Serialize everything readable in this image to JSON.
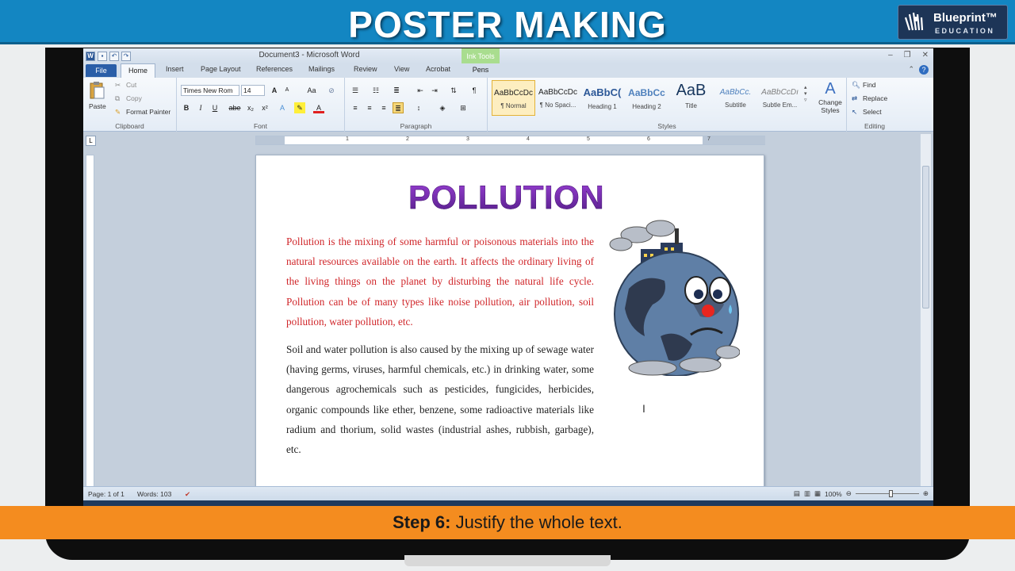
{
  "banner": {
    "title": "POSTER MAKING",
    "logo_name": "Blueprint™",
    "logo_sub": "EDUCATION"
  },
  "window": {
    "title": "Document3 - Microsoft Word",
    "context_tab": "Ink Tools"
  },
  "tabs": {
    "file": "File",
    "home": "Home",
    "insert": "Insert",
    "page_layout": "Page Layout",
    "references": "References",
    "mailings": "Mailings",
    "review": "Review",
    "view": "View",
    "acrobat": "Acrobat",
    "pens": "Pens"
  },
  "clipboard": {
    "paste": "Paste",
    "cut": "Cut",
    "copy": "Copy",
    "format_painter": "Format Painter",
    "label": "Clipboard"
  },
  "font": {
    "name": "Times New Rom",
    "size": "14",
    "label": "Font",
    "bold": "B",
    "italic": "I",
    "underline": "U",
    "strike": "abe",
    "sub": "x₂",
    "sup": "x²",
    "grow": "A",
    "shrink": "A",
    "case": "Aa"
  },
  "paragraph": {
    "label": "Paragraph"
  },
  "styles": {
    "label": "Styles",
    "items": [
      {
        "preview": "AaBbCcDc",
        "name": "¶ Normal"
      },
      {
        "preview": "AaBbCcDc",
        "name": "¶ No Spaci..."
      },
      {
        "preview": "AaBbC(",
        "name": "Heading 1"
      },
      {
        "preview": "AaBbCc",
        "name": "Heading 2"
      },
      {
        "preview": "AaB",
        "name": "Title"
      },
      {
        "preview": "AaBbCc.",
        "name": "Subtitle"
      },
      {
        "preview": "AaBbCcDı",
        "name": "Subtle Em..."
      }
    ],
    "change_styles": "Change Styles"
  },
  "editing": {
    "find": "Find",
    "replace": "Replace",
    "select": "Select",
    "label": "Editing"
  },
  "ruler": {
    "numbers": [
      "1",
      "2",
      "3",
      "4",
      "5",
      "6",
      "7"
    ]
  },
  "document": {
    "heading": "POLLUTION",
    "paragraph1": "Pollution is the mixing of some harmful or poisonous materials into the natural resources available on the earth. It affects the ordinary living of the living things on the planet by disturbing the natural life cycle. Pollution can be of many types like noise pollution, air pollution, soil pollution, water pollution, etc.",
    "paragraph2": "Soil and water pollution is also caused by the mixing up of sewage water (having germs, viruses, harmful chemicals, etc.) in drinking water, some dangerous agrochemicals such as pesticides, fungicides, herbicides, organic compounds like ether, benzene, some radioactive materials like radium and thorium, solid wastes (industrial ashes, rubbish, garbage), etc."
  },
  "status": {
    "page": "Page: 1 of 1",
    "words": "Words: 103",
    "zoom": "100%"
  },
  "step": {
    "prefix": "Step 6:",
    "text": " Justify the whole text."
  },
  "colors": {
    "banner": "#1386c2",
    "step_bar": "#f48c1f",
    "heading_purple": "#7b2fbe",
    "paragraph_red": "#d0262a"
  }
}
